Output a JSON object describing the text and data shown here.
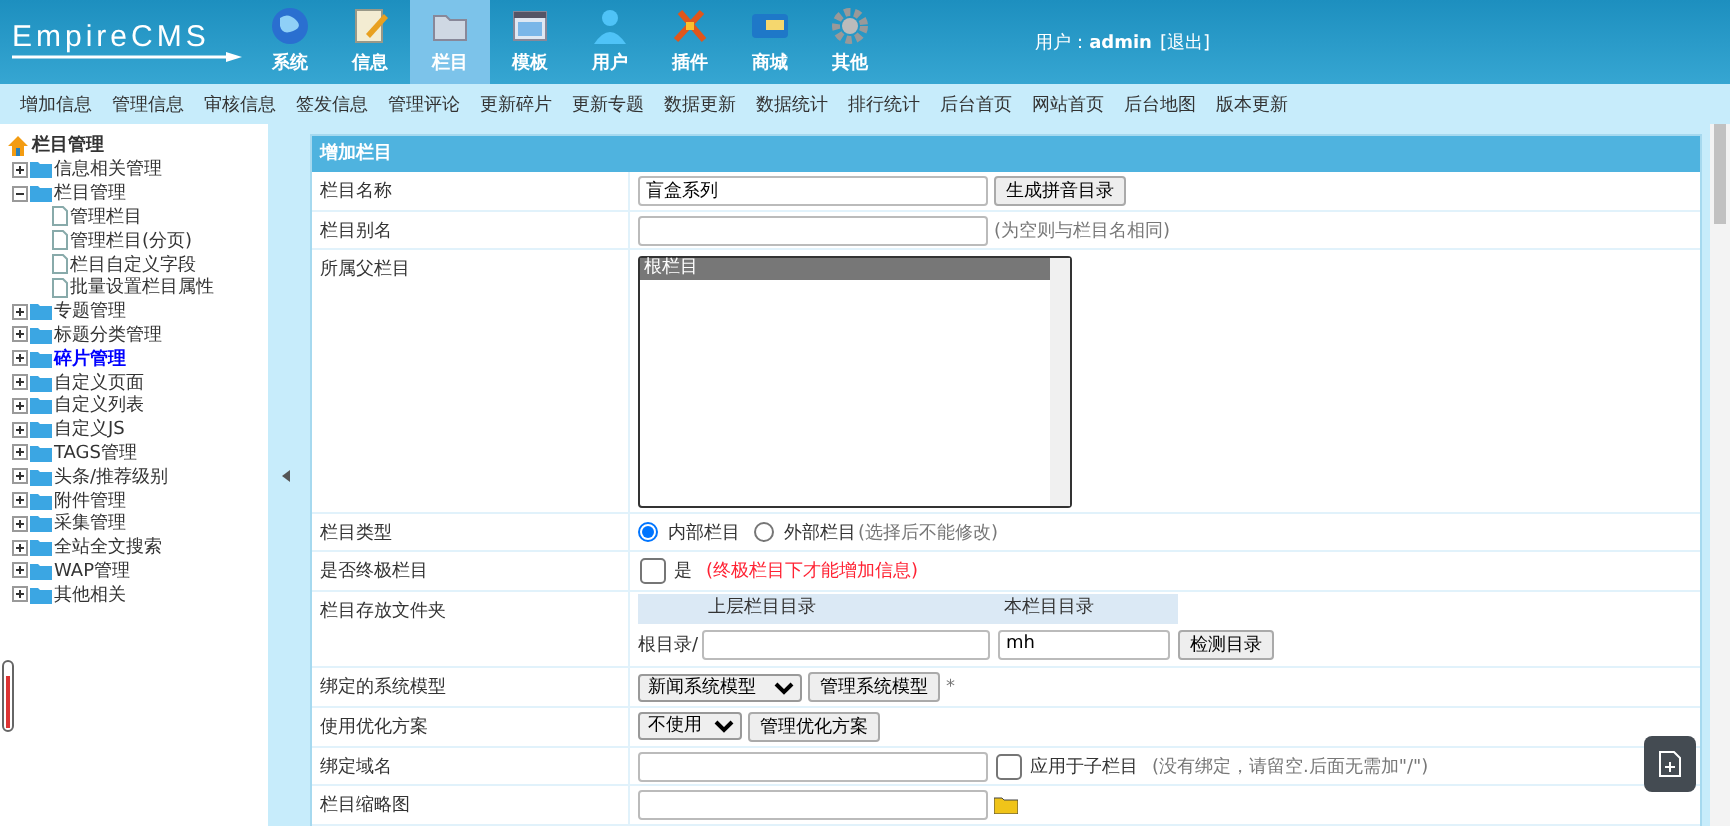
{
  "header": {
    "logo": "EmpireCMS",
    "menu": [
      {
        "label": "系统",
        "selected": false
      },
      {
        "label": "信息",
        "selected": false
      },
      {
        "label": "栏目",
        "selected": true
      },
      {
        "label": "模板",
        "selected": false
      },
      {
        "label": "用户",
        "selected": false
      },
      {
        "label": "插件",
        "selected": false
      },
      {
        "label": "商城",
        "selected": false
      },
      {
        "label": "其他",
        "selected": false
      }
    ],
    "user_label": "用户：",
    "user": "admin",
    "logout": "[退出]"
  },
  "nav": [
    "增加信息",
    "管理信息",
    "审核信息",
    "签发信息",
    "管理评论",
    "更新碎片",
    "更新专题",
    "数据更新",
    "数据统计",
    "排行统计",
    "后台首页",
    "网站首页",
    "后台地图",
    "版本更新"
  ],
  "sidebar": {
    "title": "栏目管理",
    "items": [
      {
        "label": "信息相关管理",
        "expanded": false,
        "selected": false
      },
      {
        "label": "栏目管理",
        "expanded": true,
        "selected": false,
        "children": [
          "管理栏目",
          "管理栏目(分页)",
          "栏目自定义字段",
          "批量设置栏目属性"
        ]
      },
      {
        "label": "专题管理",
        "expanded": false,
        "selected": false
      },
      {
        "label": "标题分类管理",
        "expanded": false,
        "selected": false
      },
      {
        "label": "碎片管理",
        "expanded": false,
        "selected": true
      },
      {
        "label": "自定义页面",
        "expanded": false,
        "selected": false
      },
      {
        "label": "自定义列表",
        "expanded": false,
        "selected": false
      },
      {
        "label": "自定义JS",
        "expanded": false,
        "selected": false
      },
      {
        "label": "TAGS管理",
        "expanded": false,
        "selected": false
      },
      {
        "label": "头条/推荐级别",
        "expanded": false,
        "selected": false
      },
      {
        "label": "附件管理",
        "expanded": false,
        "selected": false
      },
      {
        "label": "采集管理",
        "expanded": false,
        "selected": false
      },
      {
        "label": "全站全文搜索",
        "expanded": false,
        "selected": false
      },
      {
        "label": "WAP管理",
        "expanded": false,
        "selected": false
      },
      {
        "label": "其他相关",
        "expanded": false,
        "selected": false
      }
    ]
  },
  "form": {
    "title": "增加栏目",
    "rows": [
      {
        "kind": "input",
        "label": "栏目名称",
        "value": "盲盒系列",
        "button": "生成拼音目录"
      },
      {
        "kind": "input",
        "label": "栏目别名",
        "hint": "(为空则与栏目名相同)"
      },
      {
        "kind": "listbox",
        "label": "所属父栏目",
        "options": [
          {
            "label": "根栏目",
            "selected": true
          }
        ]
      },
      {
        "kind": "radio",
        "label": "栏目类型",
        "options": [
          {
            "label": "内部栏目",
            "selected": true
          },
          {
            "label": "外部栏目",
            "selected": false
          }
        ],
        "hint": "(选择后不能修改)"
      },
      {
        "kind": "checkbox",
        "label": "是否终极栏目",
        "option": "是",
        "checked": false,
        "hint": "(终极栏目下才能增加信息)"
      },
      {
        "kind": "folder",
        "label": "栏目存放文件夹",
        "columns": [
          "上层栏目目录",
          "本栏目目录"
        ],
        "prefix": "根目录/",
        "value": "mh",
        "button": "检测目录"
      },
      {
        "kind": "select",
        "label": "绑定的系统模型",
        "value": "新闻系统模型",
        "button": "管理系统模型",
        "mark": "*"
      },
      {
        "kind": "select",
        "label": "使用优化方案",
        "value": "不使用",
        "button": "管理优化方案"
      },
      {
        "kind": "input",
        "label": "绑定域名",
        "check": {
          "label": "应用于子栏目",
          "checked": false
        },
        "hint": "(没有绑定，请留空.后面无需加\"/\")"
      },
      {
        "kind": "file",
        "label": "栏目缩略图"
      }
    ]
  }
}
